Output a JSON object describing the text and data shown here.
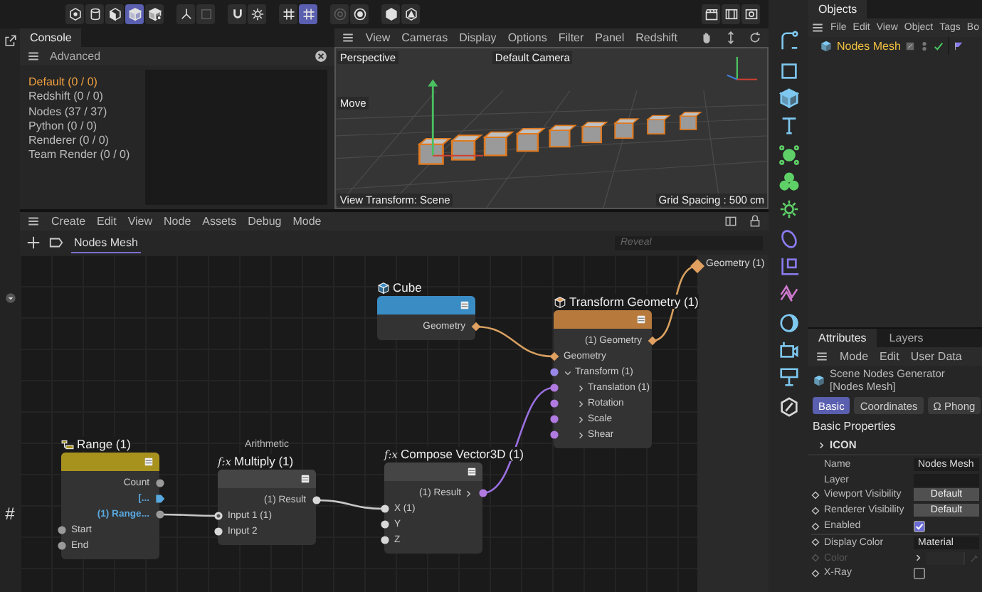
{
  "toolbar": {
    "groups": [
      {
        "buttons": [
          {
            "kind": "hexagon",
            "selected": false,
            "disabled": false
          },
          {
            "kind": "cylinder",
            "selected": false,
            "disabled": false
          },
          {
            "kind": "halfcube",
            "selected": false,
            "disabled": false
          },
          {
            "kind": "cube",
            "selected": true,
            "disabled": false
          },
          {
            "kind": "cubestar",
            "selected": false,
            "disabled": false
          }
        ]
      },
      {
        "buttons": [
          {
            "kind": "axis",
            "selected": false,
            "disabled": false
          },
          {
            "kind": "square",
            "selected": false,
            "disabled": true
          }
        ]
      },
      {
        "buttons": [
          {
            "kind": "magnet",
            "selected": false,
            "disabled": false
          },
          {
            "kind": "gear",
            "selected": false,
            "disabled": false
          }
        ]
      },
      {
        "buttons": [
          {
            "kind": "grid",
            "selected": false,
            "disabled": false
          },
          {
            "kind": "grid",
            "selected": true,
            "disabled": false
          }
        ]
      },
      {
        "buttons": [
          {
            "kind": "ring",
            "selected": false,
            "disabled": true
          },
          {
            "kind": "target",
            "selected": false,
            "disabled": false
          }
        ]
      },
      {
        "buttons": [
          {
            "kind": "hexsolid",
            "selected": false,
            "disabled": false
          },
          {
            "kind": "hexletter",
            "selected": false,
            "disabled": false
          }
        ]
      },
      {
        "buttons": [
          {
            "kind": "clapper",
            "selected": false,
            "disabled": false
          },
          {
            "kind": "film",
            "selected": false,
            "disabled": false
          },
          {
            "kind": "filmgear",
            "selected": false,
            "disabled": false
          }
        ]
      }
    ]
  },
  "left_strip": {
    "label": "#"
  },
  "console": {
    "tab": "Console",
    "header": "Advanced",
    "items": [
      {
        "label": "Default (0 / 0)",
        "selected": true
      },
      {
        "label": "Redshift (0 / 0)",
        "selected": false
      },
      {
        "label": "Nodes (37 / 37)",
        "selected": false
      },
      {
        "label": "Python (0 / 0)",
        "selected": false
      },
      {
        "label": "Renderer (0 / 0)",
        "selected": false
      },
      {
        "label": "Team Render  (0 / 0)",
        "selected": false
      }
    ]
  },
  "viewport": {
    "menu": [
      "View",
      "Cameras",
      "Display",
      "Options",
      "Filter",
      "Panel",
      "Redshift"
    ],
    "camera_view": "Perspective",
    "camera": "Default Camera",
    "tool": "Move",
    "view_transform": "View Transform: Scene",
    "grid_spacing": "Grid Spacing : 500 cm"
  },
  "node_editor": {
    "menu": [
      "Create",
      "Edit",
      "View",
      "Node",
      "Assets",
      "Debug",
      "Mode"
    ],
    "tab": {
      "label": "Nodes Mesh",
      "selected": true
    },
    "search": {
      "placeholder": "Reveal"
    },
    "nodes": [
      {
        "title": "Cube",
        "kind": "cube",
        "color": "#3a8cc4",
        "outputs": [
          {
            "label": "Geometry",
            "kind": "diamond",
            "color": "#e0a060",
            "accent": false
          }
        ]
      },
      {
        "title": "Transform Geometry (1)",
        "kind": "box",
        "color": "#b87a3c",
        "outputs": [
          {
            "label": "(1) Geometry",
            "kind": "diamond",
            "color": "#e0a060",
            "accent": false
          }
        ],
        "inputs": [
          {
            "label": "Geometry",
            "kind": "diamond",
            "color": "#e0a060",
            "accent": false
          },
          {
            "label": "Transform (1)",
            "kind": "dot",
            "color": "#9a88e8",
            "accent": false,
            "expanded": true,
            "children": [
              {
                "label": "Translation (1)",
                "kind": "dot",
                "color": "#b07ae0",
                "accent": false,
                "expanded": false
              },
              {
                "label": "Rotation",
                "kind": "dot",
                "color": "#b07ae0",
                "accent": false,
                "expanded": false
              },
              {
                "label": "Scale",
                "kind": "dot",
                "color": "#b07ae0",
                "accent": false,
                "expanded": false
              },
              {
                "label": "Shear",
                "kind": "dot",
                "color": "#b07ae0",
                "accent": false,
                "expanded": false
              }
            ]
          }
        ]
      },
      {
        "title": "Range (1)",
        "kind": "range",
        "color": "#a8921e",
        "outputs": [
          {
            "label": "Count",
            "kind": "dot",
            "color": "#9a9a9a",
            "accent": false
          },
          {
            "label": "[...",
            "kind": "arrow",
            "color": "#58a8e0",
            "accent": true
          },
          {
            "label": "(1) Range...",
            "kind": "dot",
            "color": "#9a9a9a",
            "accent": true
          }
        ],
        "inputs": [
          {
            "label": "Start",
            "kind": "dot",
            "color": "#9a9a9a",
            "accent": false
          },
          {
            "label": "End",
            "kind": "dot",
            "color": "#9a9a9a",
            "accent": false
          }
        ]
      },
      {
        "title": "Multiply (1)",
        "subtitle": "Arithmetic",
        "icon_text": "f:x",
        "color": "#454545",
        "outputs": [
          {
            "label": "(1) Result",
            "kind": "dot",
            "color": "#d8d8d8",
            "accent": false
          }
        ],
        "inputs": [
          {
            "label": "Input 1 (1)",
            "kind": "ring",
            "color": "#d8d8d8",
            "accent": false
          },
          {
            "label": "Input 2",
            "kind": "dot",
            "color": "#d8d8d8",
            "accent": false
          }
        ]
      },
      {
        "title": "Compose Vector3D (1)",
        "icon_text": "f:x",
        "color": "#454545",
        "outputs": [
          {
            "label": "(1) Result",
            "kind": "dot",
            "color": "#b07ae0",
            "accent": false,
            "expanded": false
          }
        ],
        "inputs": [
          {
            "label": "X (1)",
            "kind": "dot",
            "color": "#d8d8d8",
            "accent": false
          },
          {
            "label": "Y",
            "kind": "dot",
            "color": "#d8d8d8",
            "accent": false
          },
          {
            "label": "Z",
            "kind": "dot",
            "color": "#d8d8d8",
            "accent": false
          }
        ]
      }
    ],
    "output": {
      "label": "Geometry (1)"
    }
  },
  "palette": [
    [
      {
        "kind": "path",
        "color": "#7ec8f0"
      }
    ],
    [
      {
        "kind": "square",
        "color": "#7ec8f0"
      },
      {
        "kind": "cube",
        "color": "#7ec8f0"
      },
      {
        "kind": "lettert",
        "color": "#7ec8f0"
      }
    ],
    [
      {
        "kind": "sphere",
        "color": "#5fd068"
      },
      {
        "kind": "blobs",
        "color": "#5fd068"
      },
      {
        "kind": "gear",
        "color": "#5fd068"
      }
    ],
    [
      {
        "kind": "ellipse",
        "color": "#8a7cf0"
      },
      {
        "kind": "axisbox",
        "color": "#8a7cf0"
      },
      {
        "kind": "zigzag",
        "color": "#d07ad0"
      }
    ],
    [
      {
        "kind": "moon",
        "color": "#7ec8f0"
      },
      {
        "kind": "camera",
        "color": "#7ec8f0"
      },
      {
        "kind": "lamp",
        "color": "#7ec8f0"
      }
    ],
    [
      {
        "kind": "pencil",
        "color": "#d8d8d8"
      }
    ]
  ],
  "objects": {
    "tab": "Objects",
    "menu": [
      "File",
      "Edit",
      "View",
      "Object",
      "Tags",
      "Bo"
    ],
    "items": [
      {
        "label": "Nodes Mesh",
        "selected": true,
        "enabled": true
      }
    ]
  },
  "attributes": {
    "tabs": [
      {
        "label": "Attributes",
        "selected": true
      },
      {
        "label": "Layers",
        "selected": false
      }
    ],
    "menu": [
      "Mode",
      "Edit",
      "User Data"
    ],
    "title": "Scene Nodes Generator [Nodes Mesh]",
    "subtabs": [
      {
        "label": "Basic",
        "selected": true
      },
      {
        "label": "Coordinates",
        "selected": false
      },
      {
        "label": "Ω Phong",
        "selected": false
      }
    ],
    "section": "Basic Properties",
    "group": {
      "label": "ICON",
      "expanded": false
    },
    "rows": [
      {
        "label": "Name",
        "kind": "field",
        "value": "Nodes Mesh",
        "animatable": false,
        "disabled": false
      },
      {
        "label": "Layer",
        "kind": "field",
        "animatable": false,
        "disabled": false
      },
      {
        "label": "Viewport Visibility",
        "kind": "dropdown",
        "value": "Default",
        "animatable": true,
        "disabled": false
      },
      {
        "label": "Renderer Visibility",
        "kind": "dropdown",
        "value": "Default",
        "animatable": true,
        "disabled": false
      },
      {
        "label": "Enabled",
        "kind": "checkbox",
        "checked": true,
        "animatable": true,
        "disabled": false
      },
      {
        "label": "Display Color",
        "kind": "select",
        "value": "Material",
        "animatable": true,
        "disabled": false
      },
      {
        "label": "Color",
        "kind": "color",
        "animatable": true,
        "disabled": true
      },
      {
        "label": "X-Ray",
        "kind": "checkbox",
        "checked": false,
        "animatable": true,
        "disabled": false
      }
    ]
  }
}
